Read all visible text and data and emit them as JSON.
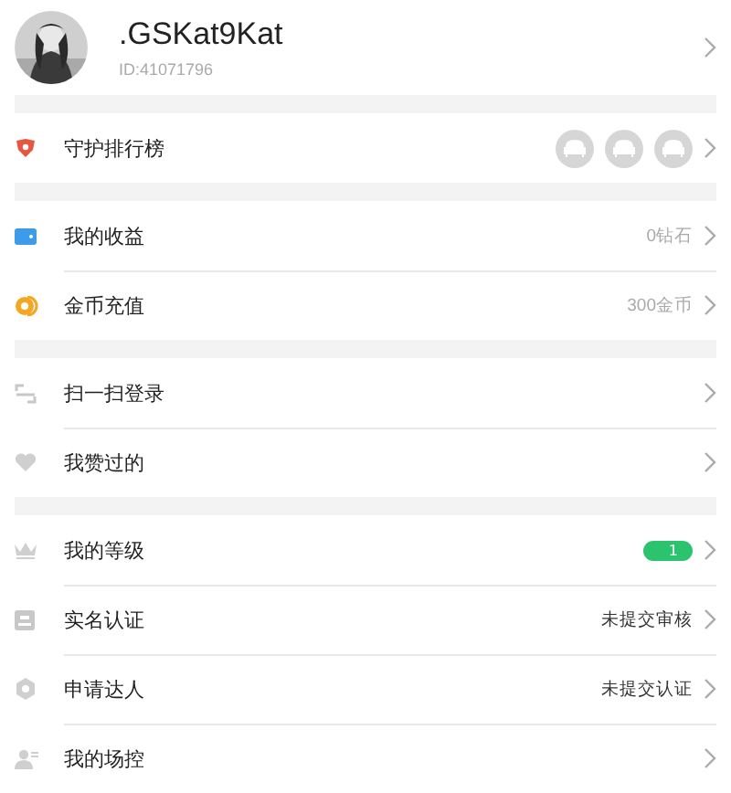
{
  "profile": {
    "name": ".GSKat9Kat",
    "id": "ID:41071796"
  },
  "sections": [
    {
      "rows": [
        {
          "label": "守护排行榜",
          "kind": "guardians",
          "seats": [
            {
              "filled": false
            },
            {
              "filled": false
            },
            {
              "filled": false
            }
          ]
        }
      ]
    },
    {
      "rows": [
        {
          "label": "我的收益",
          "kind": "value",
          "value": "0钻石"
        },
        {
          "label": "金币充值",
          "kind": "value",
          "value": "300金币"
        }
      ]
    },
    {
      "rows": [
        {
          "label": "扫一扫登录",
          "kind": "plain"
        },
        {
          "label": "我赞过的",
          "kind": "plain"
        }
      ]
    },
    {
      "rows": [
        {
          "label": "我的等级",
          "kind": "badge",
          "value": "1"
        },
        {
          "label": "实名认证",
          "kind": "status",
          "value": "未提交审核"
        },
        {
          "label": "申请达人",
          "kind": "status",
          "value": "未提交认证"
        },
        {
          "label": "我的场控",
          "kind": "plain"
        }
      ]
    }
  ]
}
